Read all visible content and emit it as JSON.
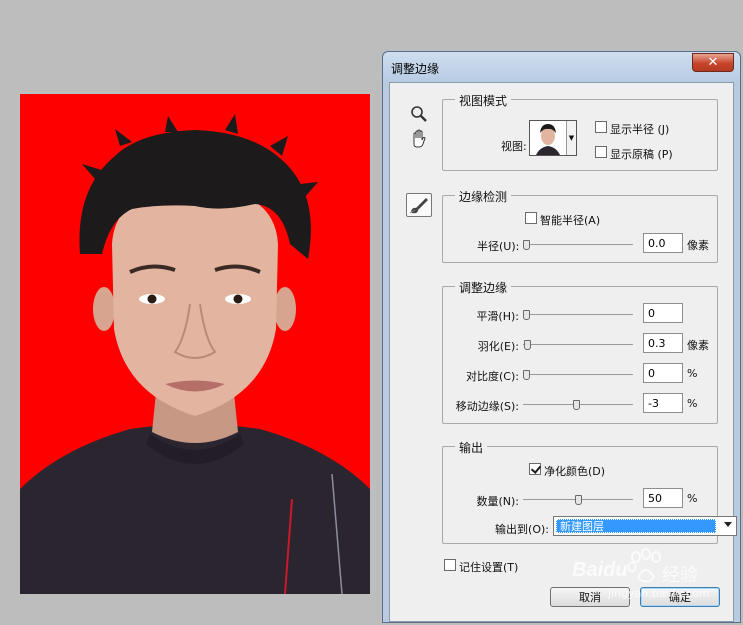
{
  "dialog": {
    "title": "调整边缘",
    "close_label": "✕"
  },
  "view_mode": {
    "group_title": "视图模式",
    "view_label": "视图:",
    "show_radius_label": "显示半径 (J)",
    "show_radius_checked": false,
    "show_original_label": "显示原稿 (P)",
    "show_original_checked": false
  },
  "edge_detection": {
    "group_title": "边缘检测",
    "smart_radius_label": "智能半径(A)",
    "smart_radius_checked": false,
    "radius_label": "半径(U):",
    "radius_value": "0.0",
    "radius_unit": "像素",
    "radius_slider_fraction": 0.0
  },
  "adjust_edge": {
    "group_title": "调整边缘",
    "smooth_label": "平滑(H):",
    "smooth_value": "0",
    "smooth_slider_fraction": 0.0,
    "feather_label": "羽化(E):",
    "feather_value": "0.3",
    "feather_unit": "像素",
    "feather_slider_fraction": 0.01,
    "contrast_label": "对比度(C):",
    "contrast_value": "0",
    "contrast_unit": "%",
    "contrast_slider_fraction": 0.0,
    "shift_edge_label": "移动边缘(S):",
    "shift_edge_value": "-3",
    "shift_edge_unit": "%",
    "shift_edge_slider_fraction": 0.485
  },
  "output": {
    "group_title": "输出",
    "decontaminate_label": "净化颜色(D)",
    "decontaminate_checked": true,
    "amount_label": "数量(N):",
    "amount_value": "50",
    "amount_unit": "%",
    "amount_slider_fraction": 0.5,
    "output_to_label": "输出到(O):",
    "output_to_value": "新建图层"
  },
  "remember_settings_label": "记住设置(T)",
  "remember_settings_checked": false,
  "cancel_label": "取消",
  "ok_label": "确定",
  "watermark": {
    "brand": "Baidu",
    "brand_cn": "经验",
    "url": "jingyan.baidu.com"
  },
  "colors": {
    "photo_background": "#ff0000",
    "selection_highlight": "#3399ff"
  },
  "icons": [
    "zoom-icon",
    "hand-icon",
    "refine-radius-brush-icon",
    "close-icon",
    "checkbox-icon",
    "dropdown-arrow-icon",
    "baidu-paw-icon"
  ]
}
